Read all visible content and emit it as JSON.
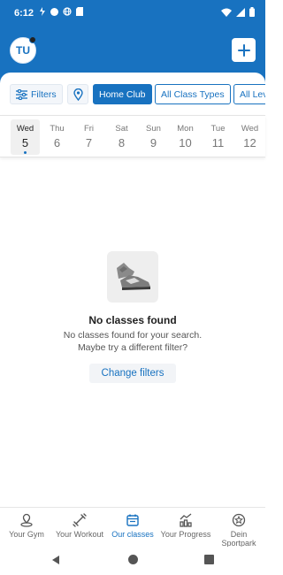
{
  "status_bar": {
    "time": "6:12"
  },
  "header": {
    "avatar_initials": "TU"
  },
  "filters": {
    "filters_label": "Filters",
    "home_club_label": "Home Club",
    "class_types_label": "All Class Types",
    "levels_label": "All Lev"
  },
  "days": [
    {
      "dow": "Wed",
      "num": "5"
    },
    {
      "dow": "Thu",
      "num": "6"
    },
    {
      "dow": "Fri",
      "num": "7"
    },
    {
      "dow": "Sat",
      "num": "8"
    },
    {
      "dow": "Sun",
      "num": "9"
    },
    {
      "dow": "Mon",
      "num": "10"
    },
    {
      "dow": "Tue",
      "num": "11"
    },
    {
      "dow": "Wed",
      "num": "12"
    }
  ],
  "empty_state": {
    "title": "No classes found",
    "line1": "No classes found for your search.",
    "line2": "Maybe try a different filter?",
    "button_label": "Change filters"
  },
  "bottom_nav": [
    {
      "label": "Your Gym",
      "icon": "gym-location-icon"
    },
    {
      "label": "Your Workout",
      "icon": "dumbbell-icon"
    },
    {
      "label": "Our classes",
      "icon": "calendar-icon",
      "active": true
    },
    {
      "label": "Your Progress",
      "icon": "chart-icon"
    },
    {
      "label": "Dein Sportpark",
      "icon": "star-circle-icon"
    }
  ],
  "colors": {
    "brand": "#1872c0",
    "background": "#ffffff"
  }
}
